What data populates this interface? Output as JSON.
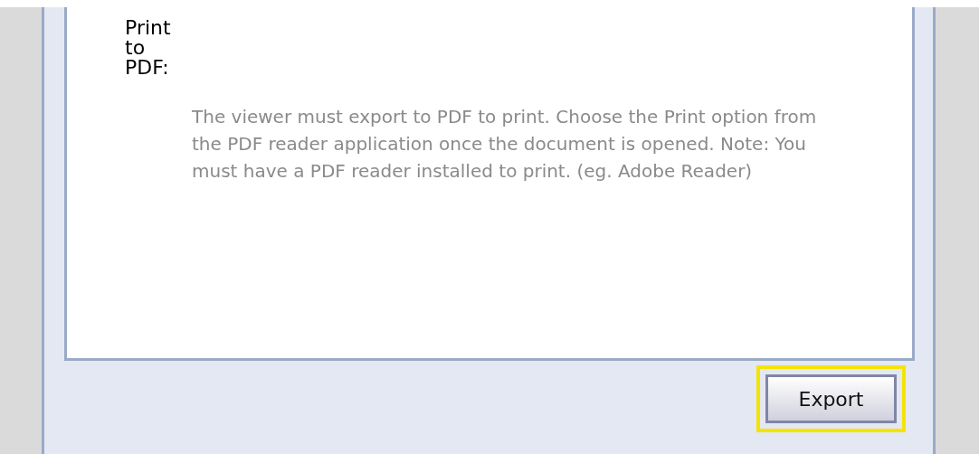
{
  "option": {
    "label": "Print to PDF:",
    "description": "The viewer must export to PDF to print. Choose the Print option from the PDF reader application once the document is opened. Note: You must have a PDF reader installed to print. (eg. Adobe Reader)"
  },
  "export_button": {
    "label": "Export",
    "highlighted": true
  }
}
